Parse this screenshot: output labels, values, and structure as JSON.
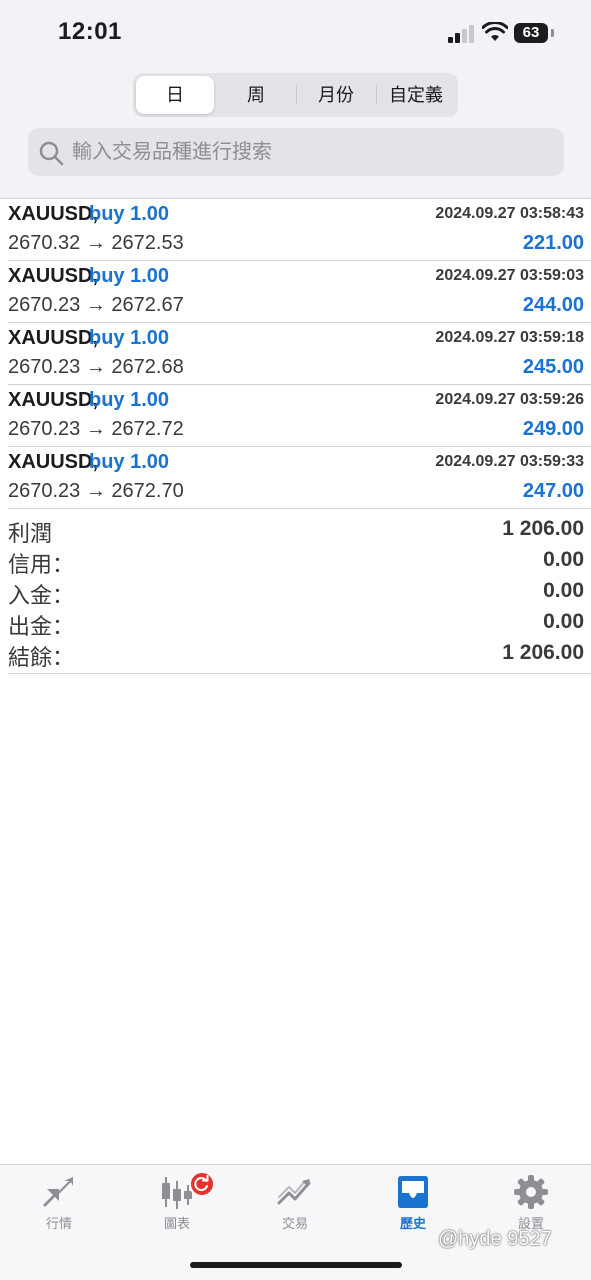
{
  "status_bar": {
    "time": "12:01",
    "battery": "63"
  },
  "periods": [
    {
      "label": "日",
      "active": true
    },
    {
      "label": "周",
      "active": false
    },
    {
      "label": "月份",
      "active": false
    },
    {
      "label": "自定義",
      "active": false
    }
  ],
  "search": {
    "placeholder": "輸入交易品種進行搜索",
    "value": ""
  },
  "deals": [
    {
      "symbol": "XAUUSD,",
      "type": "buy 1.00",
      "time": "2024.09.27 03:58:43",
      "prices": "2670.32 → 2672.53",
      "profit": "221.00"
    },
    {
      "symbol": "XAUUSD,",
      "type": "buy 1.00",
      "time": "2024.09.27 03:59:03",
      "prices": "2670.23 → 2672.67",
      "profit": "244.00"
    },
    {
      "symbol": "XAUUSD,",
      "type": "buy 1.00",
      "time": "2024.09.27 03:59:18",
      "prices": "2670.23 → 2672.68",
      "profit": "245.00"
    },
    {
      "symbol": "XAUUSD,",
      "type": "buy 1.00",
      "time": "2024.09.27 03:59:26",
      "prices": "2670.23 → 2672.72",
      "profit": "249.00"
    },
    {
      "symbol": "XAUUSD,",
      "type": "buy 1.00",
      "time": "2024.09.27 03:59:33",
      "prices": "2670.23 → 2672.70",
      "profit": "247.00"
    }
  ],
  "summary": [
    {
      "label": "利潤",
      "value": "1 206.00"
    },
    {
      "label": "信用：",
      "value": "0.00"
    },
    {
      "label": "入金：",
      "value": "0.00"
    },
    {
      "label": "出金：",
      "value": "0.00"
    },
    {
      "label": "結餘：",
      "value": "1 206.00"
    }
  ],
  "tabs": [
    {
      "label": "行情",
      "icon": "quotes-icon",
      "active": false
    },
    {
      "label": "圖表",
      "icon": "chart-icon",
      "active": false
    },
    {
      "label": "交易",
      "icon": "trade-icon",
      "active": false
    },
    {
      "label": "歷史",
      "icon": "history-icon",
      "active": true
    },
    {
      "label": "設置",
      "icon": "settings-icon",
      "active": false
    }
  ],
  "colors": {
    "accent": "#1a73d1",
    "profit": "#1a73d1",
    "badge": "#e5322f",
    "inactive_icon": "#8e8e93"
  },
  "watermark": "@hyde 9527"
}
